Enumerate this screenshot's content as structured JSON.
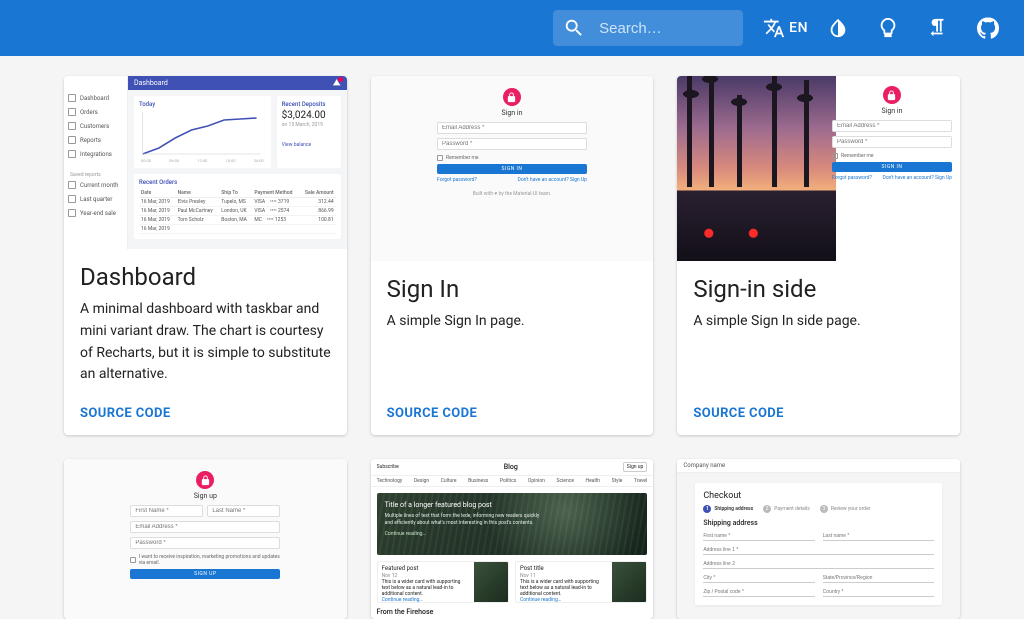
{
  "appbar": {
    "search_placeholder": "Search…",
    "lang_code": "EN"
  },
  "cards": {
    "dashboard": {
      "title": "Dashboard",
      "description": "A minimal dashboard with taskbar and mini variant draw. The chart is courtesy of Recharts, but it is simple to substitute an alternative.",
      "source_code": "SOURCE CODE",
      "thumb": {
        "appbar_title": "Dashboard",
        "nav_primary": [
          "Dashboard",
          "Orders",
          "Customers",
          "Reports",
          "Integrations"
        ],
        "nav_secondary_label": "Saved reports",
        "nav_secondary": [
          "Current month",
          "Last quarter",
          "Year-end sale"
        ],
        "chart_title": "Today",
        "deposits": {
          "title": "Recent Deposits",
          "amount": "$3,024.00",
          "date": "on 15 March, 2019",
          "link": "View balance"
        },
        "orders_title": "Recent Orders",
        "orders_cols": [
          "Date",
          "Name",
          "Ship To",
          "Payment Method",
          "Sale Amount"
        ],
        "orders_rows": [
          [
            "16 Mar, 2019",
            "Elvis Presley",
            "Tupelo, MS",
            "VISA ⠀•••• 3719",
            "312.44"
          ],
          [
            "16 Mar, 2019",
            "Paul McCartney",
            "London, UK",
            "VISA ⠀•••• 2574",
            "866.99"
          ],
          [
            "16 Mar, 2019",
            "Tom Scholz",
            "Boston, MA",
            "MC ⠀•••• 1253",
            "100.81"
          ],
          [
            "16 Mar, 2019",
            "",
            "",
            "",
            ""
          ]
        ]
      }
    },
    "signin": {
      "title": "Sign In",
      "description": "A simple Sign In page.",
      "source_code": "SOURCE CODE",
      "thumb": {
        "title": "Sign in",
        "email_label": "Email Address *",
        "password_label": "Password *",
        "remember": "Remember me",
        "button": "SIGN IN",
        "forgot": "Forgot password?",
        "signup": "Don't have an account? Sign Up",
        "footer": "Built with ♥ by the Material-UI team."
      }
    },
    "signin_side": {
      "title": "Sign-in side",
      "description": "A simple Sign In side page.",
      "source_code": "SOURCE CODE",
      "thumb": {
        "title": "Sign in",
        "email_label": "Email Address *",
        "password_label": "Password *",
        "remember": "Remember me",
        "button": "SIGN IN",
        "forgot": "Forgot password?",
        "signup": "Don't have an account? Sign Up"
      }
    },
    "signup": {
      "thumb": {
        "title": "Sign up",
        "first": "First Name *",
        "last": "Last Name *",
        "email": "Email Address *",
        "password": "Password *",
        "optin": "I want to receive inspiration, marketing promotions and updates via email.",
        "button": "SIGN UP"
      }
    },
    "blog": {
      "thumb": {
        "subscribe": "Subscribe",
        "name": "Blog",
        "signup": "Sign up",
        "cats": [
          "Technology",
          "Design",
          "Culture",
          "Business",
          "Politics",
          "Opinion",
          "Science",
          "Health",
          "Style",
          "Travel"
        ],
        "hero_title": "Title of a longer featured blog post",
        "hero_sub": "Multiple lines of text that form the lede, informing new readers quickly and efficiently about what's most interesting in this post's contents.",
        "hero_link": "Continue reading…",
        "p1_title": "Featured post",
        "p1_date": "Nov 12",
        "p1_body": "This is a wider card with supporting text below as a natural lead-in to additional content.",
        "p1_link": "Continue reading…",
        "p2_title": "Post title",
        "p2_date": "Nov 11",
        "p2_body": "This is a wider card with supporting text below as a natural lead-in to additional content.",
        "p2_link": "Continue reading…",
        "section": "From the Firehose"
      }
    },
    "checkout": {
      "thumb": {
        "brand": "Company name",
        "title": "Checkout",
        "steps": [
          "Shipping address",
          "Payment details",
          "Review your order"
        ],
        "section": "Shipping address",
        "fields": [
          "First name *",
          "Last name *",
          "Address line 1 *",
          "Address line 2",
          "City *",
          "State/Province/Region",
          "Zip / Postal code *",
          "Country *"
        ]
      }
    }
  }
}
